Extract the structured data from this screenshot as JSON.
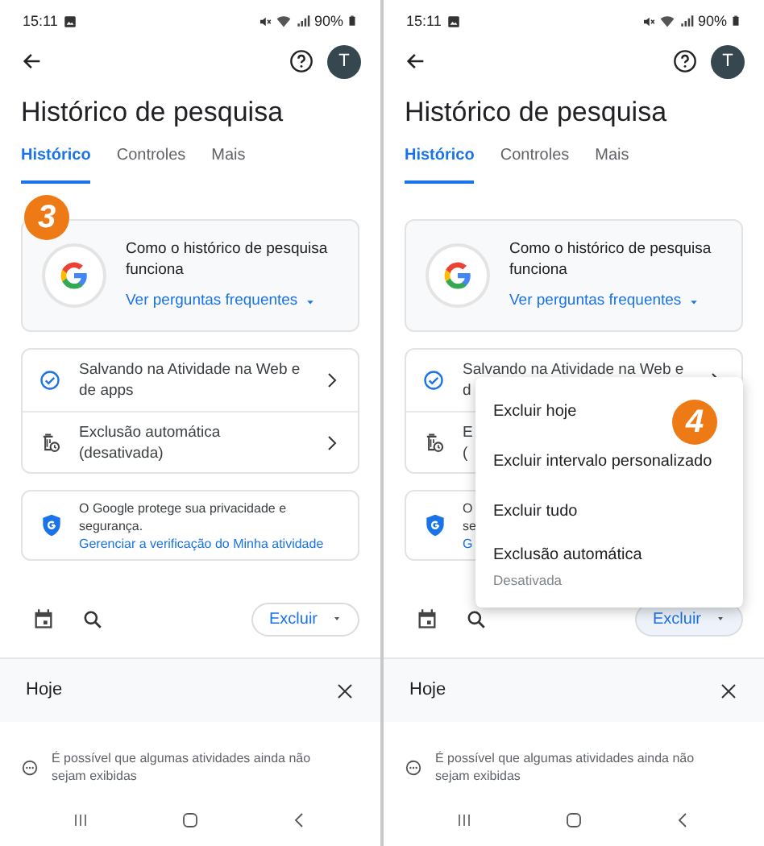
{
  "screens": [
    {
      "status_bar": {
        "time": "15:11",
        "battery": "90%"
      },
      "avatar": "T",
      "title": "Histórico de pesquisa",
      "tabs": [
        {
          "label": "Histórico",
          "selected": true
        },
        {
          "label": "Controles",
          "selected": false
        },
        {
          "label": "Mais",
          "selected": false
        }
      ],
      "info_card": {
        "step_badge": "3",
        "lines": [
          "Como o histórico de pesquisa",
          "funciona"
        ],
        "link": "Ver perguntas frequentes"
      },
      "settings": [
        {
          "kind": "web_activity",
          "lines": [
            "Salvando na Atividade na Web e",
            "de apps"
          ],
          "chevron": true
        },
        {
          "kind": "auto_delete",
          "lines": [
            "Exclusão automática",
            "(desativada)"
          ],
          "chevron": true
        }
      ],
      "privacy_card": {
        "lines": [
          "O Google protege sua privacidade e",
          "segurança."
        ],
        "link": "Gerenciar a verificação do Minha atividade"
      },
      "delete_button": "Excluir",
      "section": {
        "title": "Hoje"
      },
      "notice": [
        "É possível que algumas atividades ainda não",
        "sejam exibidas"
      ]
    },
    {
      "status_bar": {
        "time": "15:11",
        "battery": "90%"
      },
      "avatar": "T",
      "title": "Histórico de pesquisa",
      "tabs": [
        {
          "label": "Histórico",
          "selected": true
        },
        {
          "label": "Controles",
          "selected": false
        },
        {
          "label": "Mais",
          "selected": false
        }
      ],
      "info_card": {
        "lines": [
          "Como o histórico de pesquisa",
          "funciona"
        ],
        "link": "Ver perguntas frequentes"
      },
      "settings": [
        {
          "kind": "web_activity",
          "lines": [
            "Salvando na Atividade na Web e",
            "d"
          ],
          "chevron": true
        },
        {
          "kind": "auto_delete",
          "lines": [
            "E",
            "("
          ],
          "chevron": false
        }
      ],
      "privacy_card": {
        "lines": [
          "O",
          "se"
        ],
        "link": "G"
      },
      "delete_button": "Excluir",
      "section": {
        "title": "Hoje"
      },
      "notice": [
        "É possível que algumas atividades ainda não",
        "sejam exibidas"
      ],
      "menu": {
        "step_badge": "4",
        "items": [
          {
            "label": "Excluir hoje"
          },
          {
            "label": "Excluir intervalo personalizado"
          },
          {
            "label": "Excluir tudo"
          },
          {
            "label": "Exclusão automática",
            "sublabel": "Desativada"
          }
        ]
      }
    }
  ]
}
